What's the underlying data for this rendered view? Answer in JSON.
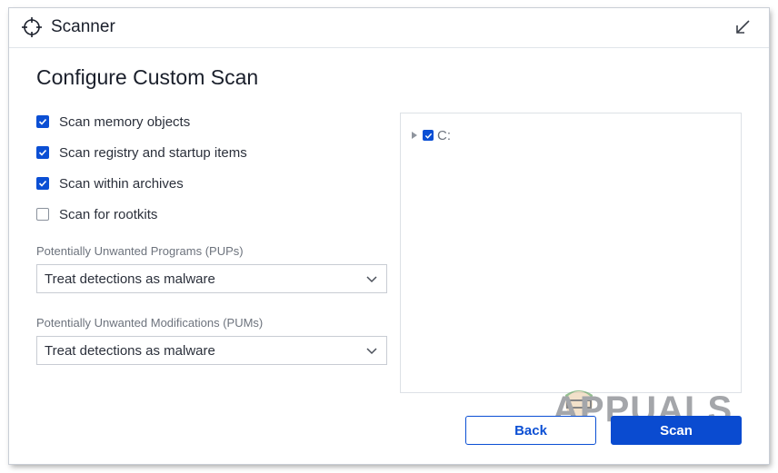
{
  "app": {
    "title": "Scanner",
    "icon": "crosshair-icon",
    "collapse_icon": "collapse-arrow-icon"
  },
  "page": {
    "title": "Configure Custom Scan"
  },
  "options": [
    {
      "label": "Scan memory objects",
      "checked": true
    },
    {
      "label": "Scan registry and startup items",
      "checked": true
    },
    {
      "label": "Scan within archives",
      "checked": true
    },
    {
      "label": "Scan for rootkits",
      "checked": false
    }
  ],
  "pups": {
    "label": "Potentially Unwanted Programs (PUPs)",
    "value": "Treat detections as malware"
  },
  "pums": {
    "label": "Potentially Unwanted Modifications (PUMs)",
    "value": "Treat detections as malware"
  },
  "drives": [
    {
      "label": "C:",
      "checked": true,
      "expanded": false
    }
  ],
  "buttons": {
    "back": "Back",
    "scan": "Scan"
  },
  "watermark": "APPUALS",
  "colors": {
    "accent": "#0b4fd4",
    "text": "#2b303b",
    "muted": "#6d737d",
    "border": "#c8ccd3"
  }
}
